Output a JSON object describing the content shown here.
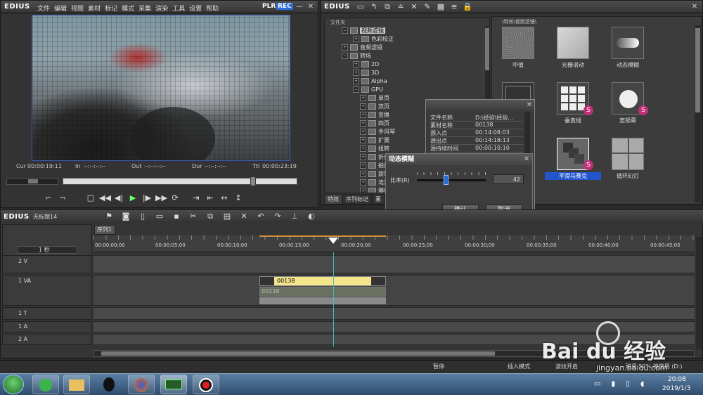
{
  "player": {
    "logo": "EDIUS",
    "menu": [
      "文件",
      "编辑",
      "视图",
      "素材",
      "标记",
      "模式",
      "采集",
      "渲染",
      "工具",
      "设置",
      "帮助"
    ],
    "plr": "PLR",
    "rec": "REC",
    "timecodes": {
      "cur_label": "Cur",
      "cur": "00:00:19:11",
      "in_label": "In",
      "in": "--:--:--:--",
      "out_label": "Out",
      "out": "--:--:--:--",
      "dur_label": "Dur",
      "dur": "--:--:--:--",
      "ttl_label": "Ttl",
      "ttl": "00:00:23:19"
    }
  },
  "library": {
    "logo": "EDIUS",
    "folder_header": "文件夹",
    "path": "\\特效\\视频滤镜\\",
    "tree": [
      {
        "label": "视频滤镜",
        "level": 1,
        "selected": true
      },
      {
        "label": "色彩校正",
        "level": 2
      },
      {
        "label": "音频滤镜",
        "level": 1
      },
      {
        "label": "转场",
        "level": 1
      },
      {
        "label": "2D",
        "level": 2
      },
      {
        "label": "3D",
        "level": 2
      },
      {
        "label": "Alpha",
        "level": 2
      },
      {
        "label": "GPU",
        "level": 2
      },
      {
        "label": "单页",
        "level": 3
      },
      {
        "label": "双页",
        "level": 3
      },
      {
        "label": "变换",
        "level": 3
      },
      {
        "label": "四页",
        "level": 3
      },
      {
        "label": "手风琴",
        "level": 3
      },
      {
        "label": "扩展",
        "level": 3
      },
      {
        "label": "扭转",
        "level": 3
      },
      {
        "label": "折叠",
        "level": 3
      },
      {
        "label": "拍打",
        "level": 3
      },
      {
        "label": "旋转",
        "level": 3
      },
      {
        "label": "涟漪",
        "level": 3
      },
      {
        "label": "爆炸",
        "level": 3
      }
    ],
    "tabs": [
      "特效",
      "序列标记",
      "素"
    ],
    "effects": [
      {
        "label": "中值"
      },
      {
        "label": "光栅滚动"
      },
      {
        "label": "动态模糊"
      },
      {
        "label": ""
      },
      {
        "label": "垂直线"
      },
      {
        "label": "宽银幕"
      },
      {
        "label": ""
      },
      {
        "label": "平滑马赛克",
        "selected": true
      },
      {
        "label": "循环幻灯"
      }
    ]
  },
  "info": {
    "rows": [
      {
        "k": "文件名称",
        "v": "D:\\经验\\经验..."
      },
      {
        "k": "素材名称",
        "v": "00138"
      },
      {
        "k": "源入点",
        "v": "00:14:08:03"
      },
      {
        "k": "源出点",
        "v": "00:14:18:13"
      },
      {
        "k": "源持续时间",
        "v": "00:00:10:10"
      }
    ],
    "footer": "信息"
  },
  "dialog": {
    "title": "动态模糊",
    "ratio_label": "比率(R)",
    "ratio_value": "42",
    "ratio_fraction": 0.42,
    "ok": "确认",
    "cancel": "取消"
  },
  "timeline": {
    "logo": "EDIUS",
    "project": "无标题14",
    "sequence_tab": "序列1",
    "scale": "1 秒",
    "ruler": [
      "00:00:00;00",
      "00:00:05;00",
      "00:00:10;00",
      "00:00:15;00",
      "00:00:20;00",
      "00:00:25;00",
      "00:00:30;00",
      "00:00:35;00",
      "00:00:40;00",
      "00:00:45;00"
    ],
    "tracks": [
      {
        "name": "2 V"
      },
      {
        "name": "1 VA"
      },
      {
        "name": "1 T"
      },
      {
        "name": "1 A"
      },
      {
        "name": "2 A"
      }
    ],
    "clip": {
      "name": "00138",
      "name_lower": "00138"
    }
  },
  "status": {
    "state": "暂停",
    "insert_mode": "插入模式",
    "ripple": "波纹开启",
    "disk": "磁盘 52% 被使用 (D:)"
  },
  "taskbar": {
    "time": "20:08",
    "date": "2019/1/3"
  },
  "watermark": {
    "brand": "Bai du 经验",
    "url": "jingyan.baidu.com"
  }
}
